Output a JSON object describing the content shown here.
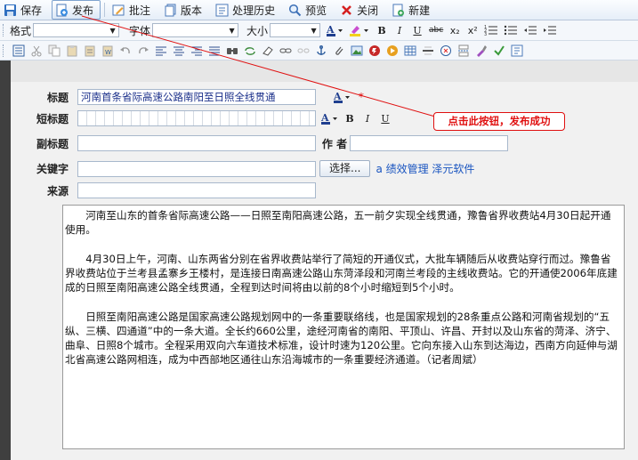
{
  "toolbar": {
    "save": "保存",
    "publish": "发布",
    "annotate": "批注",
    "version": "版本",
    "history": "处理历史",
    "preview": "预览",
    "close": "关闭",
    "new": "新建"
  },
  "format_bar": {
    "format_label": "格式",
    "font_label": "字体",
    "size_label": "大小",
    "bold": "B",
    "italic": "I",
    "underline": "U",
    "strike": "abc",
    "subscript": "x₂",
    "superscript": "x²"
  },
  "form": {
    "title_label": "标题",
    "title_value": "河南首条省际高速公路南阳至日照全线贯通",
    "short_title_label": "短标题",
    "subtitle_label": "副标题",
    "author_label": "作 者",
    "keywords_label": "关键字",
    "select_button": "选择...",
    "keyword_links": "a 绩效管理 泽元软件",
    "source_label": "来源",
    "required_mark": "*",
    "mini_bold": "B",
    "mini_italic": "I",
    "mini_underline": "U"
  },
  "callout": "点击此按钮，发布成功",
  "article": {
    "paragraphs": [
      "河南至山东的首条省际高速公路——日照至南阳高速公路，五一前夕实现全线贯通，豫鲁省界收费站4月30日起开通使用。",
      "4月30日上午，河南、山东两省分别在省界收费站举行了简短的开通仪式，大批车辆随后从收费站穿行而过。豫鲁省界收费站位于兰考县孟寨乡王楼村，是连接日南高速公路山东菏泽段和河南兰考段的主线收费站。它的开通使2006年底建成的日照至南阳高速公路全线贯通，全程到达时间将由以前的8个小时缩短到5个小时。",
      "日照至南阳高速公路是国家高速公路规划网中的一条重要联络线，也是国家规划的28条重点公路和河南省规划的“五纵、三横、四通道”中的一条大道。全长约660公里，途经河南省的南阳、平顶山、许昌、开封以及山东省的菏泽、济宁、曲阜、日照8个城市。全程采用双向六车道技术标准，设计时速为120公里。它向东接入山东到达海边，西南方向延伸与湖北省高速公路网相连，成为中西部地区通往山东沿海城市的一条重要经济通道。（记者周斌）"
    ]
  },
  "colors": {
    "accent_red": "#e01010",
    "link_blue": "#1a55c0",
    "toolbar_bg": "#e6eef8"
  }
}
